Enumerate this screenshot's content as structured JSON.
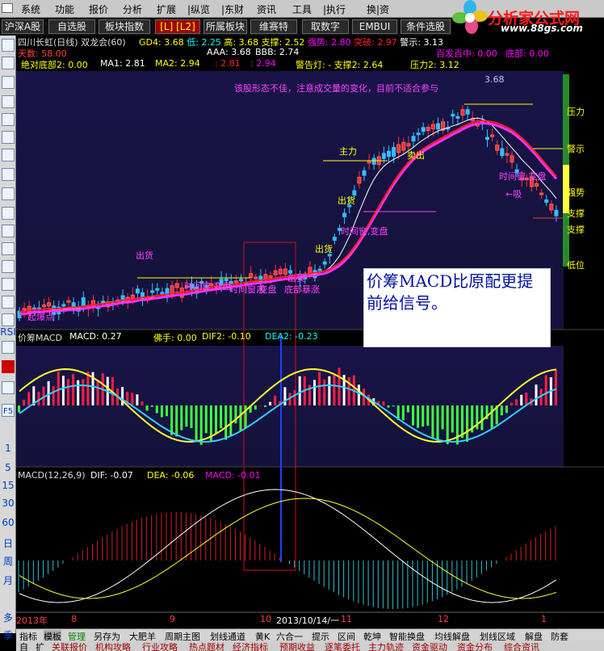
{
  "menu": [
    "系统",
    "功能",
    "报价",
    "分析",
    "扩展",
    "|纵览",
    "|东财",
    "资讯",
    "工具",
    "|执行",
    "换|资"
  ],
  "logo": {
    "brand": "分析家公式网",
    "url": "www.88gs.com"
  },
  "tabs": [
    "沪深A股",
    "自选股",
    "板块指数",
    "[L] [L2]",
    "所属板块",
    "维赛特",
    "取数字",
    "EMBUI",
    "条件选股"
  ],
  "left_toolbar": {
    "labels": [
      "RSI",
      "F5",
      "1",
      "5",
      "15",
      "30",
      "60",
      "日",
      "周",
      "月",
      "多",
      "季"
    ]
  },
  "main_pane": {
    "line1": {
      "title": "四川长虹(日线) 双龙会(60)",
      "items": [
        {
          "k": "GD4:",
          "v": "3.68",
          "c": "#ffff00"
        },
        {
          "k": "低:",
          "v": "2.25",
          "c": "#00ffff"
        },
        {
          "k": "高:",
          "v": "3.68",
          "c": "#ffff00"
        },
        {
          "k": "支撑:",
          "v": "2.52",
          "c": "#ffff00"
        },
        {
          "k": "强势:",
          "v": "2.80",
          "c": "#ff00ff"
        },
        {
          "k": "突破:",
          "v": "2.97",
          "c": "#ff2020"
        },
        {
          "k": "警示:",
          "v": "3.13",
          "c": "#ffffff"
        }
      ]
    },
    "line2": {
      "left": {
        "k": "天数:",
        "v": "58.00"
      },
      "aaa": "AAA: 3.68",
      "bbb": "BBB: 2.74",
      "right": [
        "百发百中: 0.00",
        "底部: 0.00"
      ]
    },
    "line3": {
      "dbl": "绝对底部2: 0.00",
      "ma1": "MA1: 2.81",
      "ma2": "MA2: 2.94",
      "v1": ": 2.81",
      "v2": ": 2.94",
      "warn": "警告灯: - 支撑2: 2.64",
      "press": "压力2: 3.12"
    },
    "top_value": "3.68",
    "comment": "该股形态不佳，注意成交量的变化，目前不适合参与",
    "annotations": [
      "出货",
      "主力",
      "出货",
      "卖出",
      "出货",
      "出货",
      "时间窗,变盘",
      "时间窗,变盘",
      "时间窗,变盘",
      "时间窗,变盘",
      "吸",
      "底部暴涨",
      "起爆点",
      "←吸"
    ],
    "right_labels": [
      "压力",
      "警示",
      "强势",
      "支撑",
      "支撑",
      "低位"
    ]
  },
  "note": "价筹MACD比原配更提前给信号。",
  "macd1": {
    "title": "价筹MACD",
    "items": [
      {
        "t": "MACD: 0.27",
        "c": "#ffffff"
      },
      {
        "t": "佛手: 0.00",
        "c": "#ffff00"
      },
      {
        "t": "DIF2: -0.10",
        "c": "#ffff00"
      },
      {
        "t": "DEA2: -0.23",
        "c": "#00ffff"
      }
    ]
  },
  "macd2": {
    "title": "MACD(12,26,9)",
    "items": [
      {
        "t": "DIF: -0.07",
        "c": "#ffffff"
      },
      {
        "t": "DEA: -0.06",
        "c": "#ffff00"
      },
      {
        "t": "MACD: -0.01",
        "c": "#ff00ff"
      }
    ]
  },
  "date_axis": [
    "2013年",
    "8",
    "9",
    "10",
    "2013/10/14/一",
    "11",
    "12",
    "1"
  ],
  "bottom_tabs": [
    "指标",
    "模板",
    "管理",
    "另存为",
    "大肥羊",
    "周期主图",
    "划线通道",
    "黄K",
    "六合一",
    "提示",
    "区间",
    "乾坤",
    "智能换盘",
    "均线解盘",
    "划线区域",
    "解盘",
    "防套"
  ],
  "bottom_links": [
    "自",
    "扩",
    "关联报价",
    "机构攻略",
    "行业攻略",
    "热点题材",
    "经济指标",
    "预期收益",
    "逐笔委托",
    "主力轨迹",
    "资金驱动",
    "资金分布",
    "综合资讯"
  ],
  "colors": {
    "up": "#ff2020",
    "down": "#00e060",
    "bg": "#161340",
    "accent": "#ffff00"
  }
}
